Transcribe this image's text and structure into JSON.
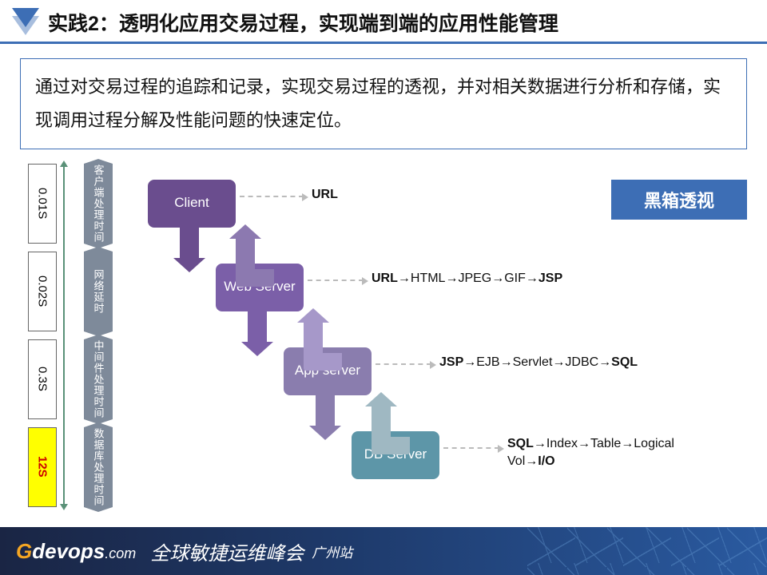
{
  "title": "实践2：透明化应用交易过程，实现端到端的应用性能管理",
  "description": "通过对交易过程的追踪和记录，实现交易过程的透视，并对相关数据进行分析和存储，实现调用过程分解及性能问题的快速定位。",
  "badge": "黑箱透视",
  "timings": [
    "0.01S",
    "0.02S",
    "0.3S",
    "12S"
  ],
  "stages": [
    "客户端处理时间",
    "网络延时",
    "中间件处理时间",
    "数据库处理时间"
  ],
  "nodes": [
    "Client",
    "Web Server",
    "App server",
    "DB Server"
  ],
  "labels": {
    "l1": "URL",
    "l2": [
      [
        "b",
        "URL"
      ],
      [
        "t",
        "→HTML→JPEG→GIF→"
      ],
      [
        "b",
        "JSP"
      ]
    ],
    "l3": [
      [
        "b",
        "JSP"
      ],
      [
        "t",
        "→EJB→Servlet→JDBC→"
      ],
      [
        "b",
        "SQL"
      ]
    ],
    "l4": [
      [
        "b",
        "SQL"
      ],
      [
        "t",
        "→Index→Table→Logical Vol→"
      ],
      [
        "b",
        "I/O"
      ]
    ]
  },
  "footer": {
    "brand_g": "G",
    "brand_d": "devops",
    "brand_c": ".com",
    "conf": "全球敏捷运维峰会",
    "city": "广州站"
  }
}
